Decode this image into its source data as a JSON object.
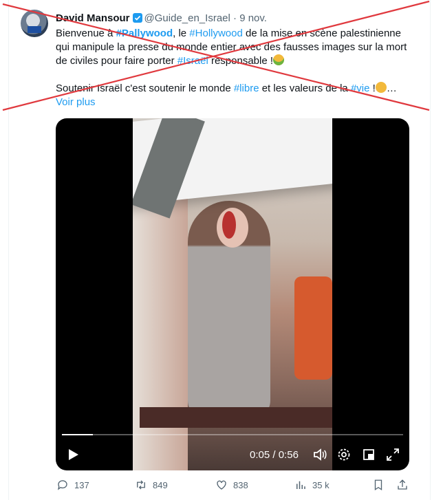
{
  "tweet": {
    "author_name": "David Mansour",
    "handle": "@Guide_en_Israel",
    "separator": " · ",
    "date": "9 nov.",
    "line1": {
      "a": "Bienvenue à ",
      "tag1": "#Pallywood",
      "b": ", le ",
      "tag2": "#Hollywood",
      "c": " de la mise en scène palestinienne qui manipule la presse du monde entier avec des fausses images sur la mort de civiles pour faire porter ",
      "tag3": "#Israël",
      "d": " responsable !"
    },
    "line2": {
      "a": "Soutenir Israël c'est soutenir le monde ",
      "tag1": "#libre",
      "b": " et les valeurs de la ",
      "tag2": "#vie",
      "c": " !",
      "ellipsis": "…"
    },
    "show_more": "Voir plus",
    "emoji1": "nauseated-face-emoji",
    "emoji2": "angry-face-emoji"
  },
  "video": {
    "current_time": "0:05",
    "time_separator": " / ",
    "duration": "0:56",
    "progress": 0.09
  },
  "actions": {
    "replies": "137",
    "reposts": "849",
    "likes": "838",
    "views": "35 k"
  },
  "colors": {
    "link": "#1d9bf0",
    "muted": "#536471",
    "cross": "#e0393e",
    "verified": "#1d9bf0"
  }
}
